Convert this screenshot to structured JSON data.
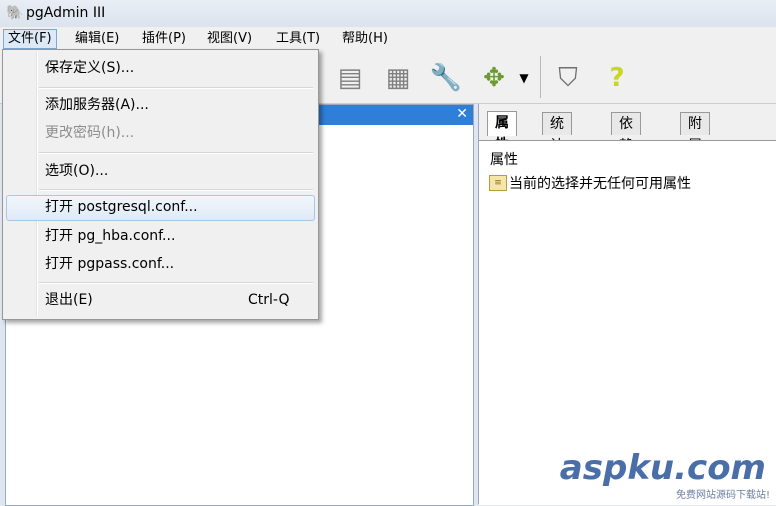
{
  "window": {
    "title": "pgAdmin III"
  },
  "menubar": {
    "items": [
      {
        "label": "文件(F)",
        "active": true
      },
      {
        "label": "编辑(E)"
      },
      {
        "label": "插件(P)"
      },
      {
        "label": "视图(V)"
      },
      {
        "label": "工具(T)"
      },
      {
        "label": "帮助(H)"
      }
    ]
  },
  "toolbar": {
    "icons": [
      "list-icon",
      "table-icon",
      "wrench-icon",
      "puzzle-plugin-icon",
      "dropdown-arrow-icon",
      "hint-icon",
      "help-icon"
    ]
  },
  "file_menu": {
    "items": [
      {
        "label": "保存定义(S)...",
        "enabled": true
      },
      {
        "label": "添加服务器(A)...",
        "enabled": true
      },
      {
        "label": "更改密码(h)...",
        "enabled": false
      },
      {
        "label": "选项(O)...",
        "enabled": true
      },
      {
        "label": "打开 postgresql.conf...",
        "enabled": true,
        "highlighted": true
      },
      {
        "label": "打开 pg_hba.conf...",
        "enabled": true
      },
      {
        "label": "打开 pgpass.conf...",
        "enabled": true
      },
      {
        "label": "退出(E)",
        "enabled": true,
        "shortcut": "Ctrl-Q"
      }
    ]
  },
  "right_pane": {
    "tabs": [
      {
        "label": "属性",
        "active": true
      },
      {
        "label": "统计量"
      },
      {
        "label": "依赖性"
      },
      {
        "label": "附属关系"
      }
    ],
    "column_header": "属性",
    "empty_message": "当前的选择并无任何可用属性"
  },
  "watermark": {
    "brand": "aspku.com",
    "caption": "免费网站源码下载站!"
  }
}
